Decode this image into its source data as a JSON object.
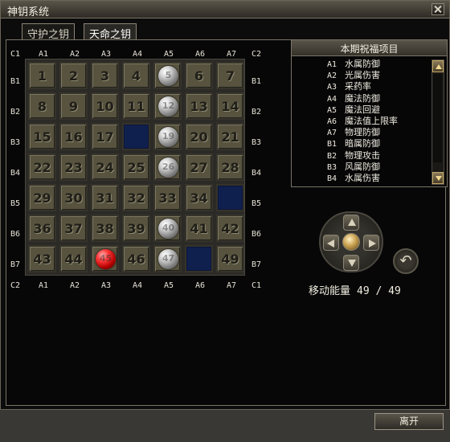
{
  "window": {
    "title": "神钥系统"
  },
  "tabs": [
    {
      "label": "守护之钥",
      "active": false
    },
    {
      "label": "天命之钥",
      "active": true
    }
  ],
  "board": {
    "col_labels": [
      "A1",
      "A2",
      "A3",
      "A4",
      "A5",
      "A6",
      "A7"
    ],
    "row_labels": [
      "B1",
      "B2",
      "B3",
      "B4",
      "B5",
      "B6",
      "B7"
    ],
    "corners": {
      "top_left": "C1",
      "top_right": "C2",
      "bottom_left": "C2",
      "bottom_right": "C1"
    },
    "cells": [
      "1",
      "2",
      "3",
      "4",
      "5",
      "6",
      "7",
      "8",
      "9",
      "10",
      "11",
      "12",
      "13",
      "14",
      "15",
      "16",
      "17",
      "",
      "19",
      "20",
      "21",
      "22",
      "23",
      "24",
      "25",
      "26",
      "27",
      "28",
      "29",
      "30",
      "31",
      "32",
      "33",
      "34",
      "",
      "36",
      "37",
      "38",
      "39",
      "40",
      "41",
      "42",
      "43",
      "44",
      "45",
      "46",
      "47",
      "",
      "49"
    ],
    "empty_cells": [
      18,
      35,
      48
    ],
    "silver_orbs": [
      5,
      12,
      19,
      26,
      40,
      47
    ],
    "red_orbs": [
      45
    ]
  },
  "blessings": {
    "title": "本期祝福项目",
    "items": [
      {
        "code": "A1",
        "label": "水属防御"
      },
      {
        "code": "A2",
        "label": "光属伤害"
      },
      {
        "code": "A3",
        "label": "采药率"
      },
      {
        "code": "A4",
        "label": "魔法防御"
      },
      {
        "code": "A5",
        "label": "魔法回避"
      },
      {
        "code": "A6",
        "label": "魔法值上限率"
      },
      {
        "code": "A7",
        "label": "物理防御"
      },
      {
        "code": "B1",
        "label": "暗属防御"
      },
      {
        "code": "B2",
        "label": "物理攻击"
      },
      {
        "code": "B3",
        "label": "风属防御"
      },
      {
        "code": "B4",
        "label": "水属伤害"
      }
    ]
  },
  "controls": {
    "icons": [
      "arrow-up-icon",
      "arrow-down-icon",
      "arrow-left-icon",
      "arrow-right-icon",
      "center-orb-icon",
      "undo-icon"
    ],
    "energy_label": "移动能量",
    "energy_value": "49 / 49"
  },
  "footer": {
    "leave_label": "离开"
  }
}
